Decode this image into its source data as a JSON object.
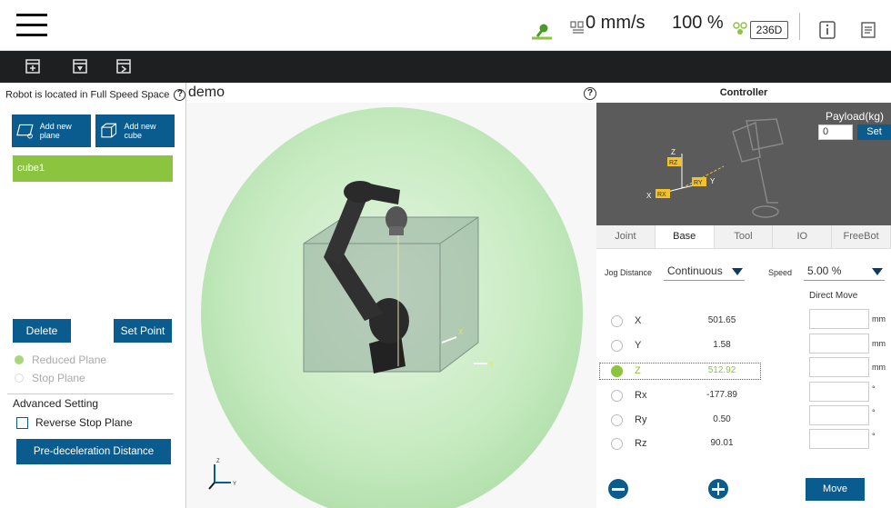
{
  "topbar": {
    "speed": "0 mm/s",
    "percent": "100 %",
    "code": "236D"
  },
  "left": {
    "location_text": "Robot is located in Full Speed Space",
    "add_plane": "Add new plane",
    "add_cube": "Add new cube",
    "items": [
      "cube1"
    ],
    "delete": "Delete",
    "set_point": "Set Point",
    "reduced_plane": "Reduced Plane",
    "stop_plane": "Stop Plane",
    "advanced_setting": "Advanced Setting",
    "reverse_stop_plane": "Reverse Stop Plane",
    "pre_decel": "Pre-deceleration Distance Setting"
  },
  "view": {
    "title": "demo",
    "axis_x": "X",
    "axis_y": "Y",
    "axis_z": "Z"
  },
  "controller": {
    "title": "Controller",
    "payload_label": "Payload(kg)",
    "payload_value": "0",
    "payload_set": "Set",
    "preview_labels": {
      "z": "Z",
      "rz": "RZ",
      "x": "X",
      "rx": "RX",
      "ry": "RY",
      "y": "Y"
    },
    "tabs": [
      "Joint",
      "Base",
      "Tool",
      "IO",
      "FreeBot"
    ],
    "active_tab": "Base",
    "jog_distance_label": "Jog Distance",
    "jog_distance_value": "Continuous",
    "speed_label": "Speed",
    "speed_value": "5.00 %",
    "direct_move": "Direct Move",
    "axes": [
      {
        "name": "X",
        "value": "501.65",
        "unit": "mm"
      },
      {
        "name": "Y",
        "value": "1.58",
        "unit": "mm"
      },
      {
        "name": "Z",
        "value": "512.92",
        "unit": "mm",
        "selected": true
      },
      {
        "name": "Rx",
        "value": "-177.89",
        "unit": "°"
      },
      {
        "name": "Ry",
        "value": "0.50",
        "unit": "°"
      },
      {
        "name": "Rz",
        "value": "90.01",
        "unit": "°"
      }
    ],
    "move": "Move"
  },
  "colors": {
    "accent_blue": "#0b5c8e",
    "green": "#8bc43f",
    "dark_bar": "#1d1f21"
  }
}
